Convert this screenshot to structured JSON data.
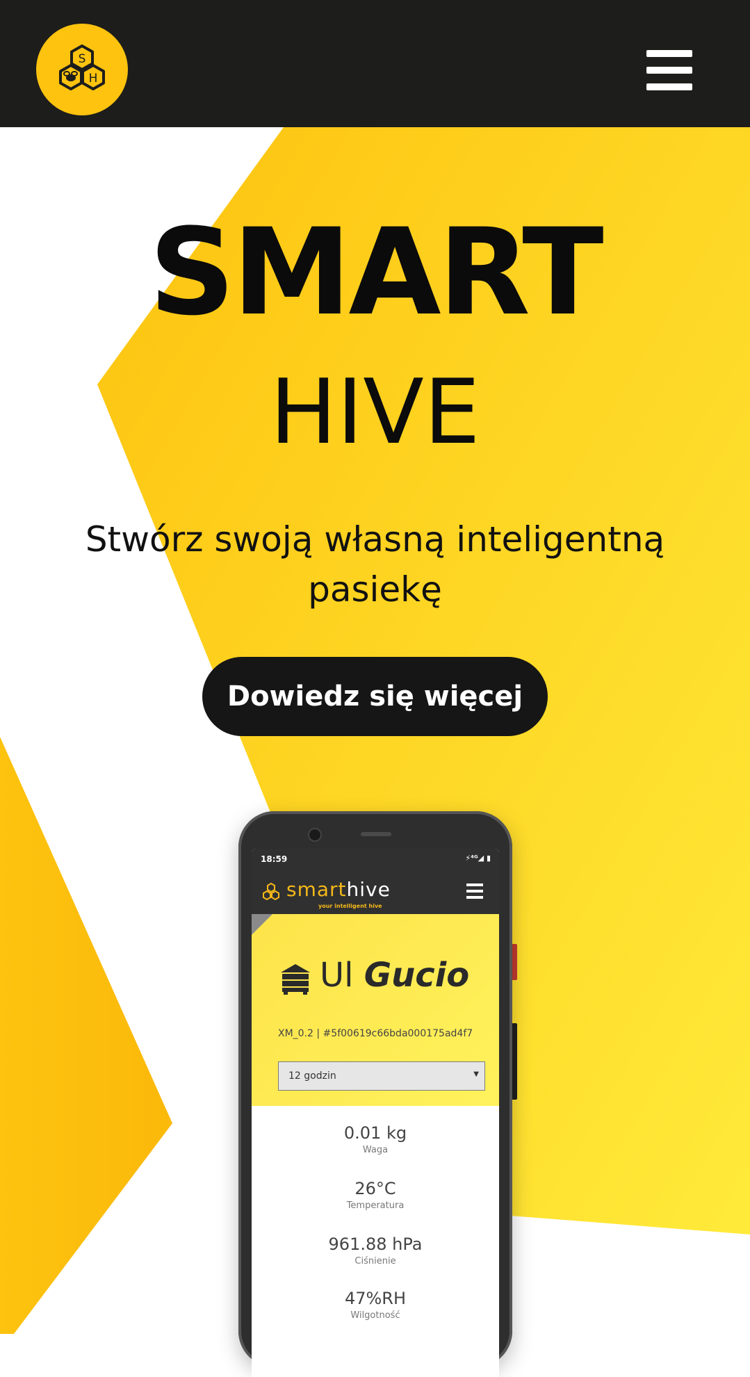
{
  "header": {
    "logo_letters": [
      "S",
      "H"
    ]
  },
  "hero": {
    "title": "SMART",
    "subtitle": "HIVE",
    "tagline": "Stwórz swoją własną inteligentną pasiekę",
    "cta_label": "Dowiedz się więcej"
  },
  "phone": {
    "status_time": "18:59",
    "status_icons": "⚡⁴ᴳ◢ ▮",
    "brand_accent": "smart",
    "brand_rest": "hive",
    "brand_tagline": "your intelligent hive",
    "hive_prefix": "Ul",
    "hive_name": "Gucio",
    "device_id": "XM_0.2 | #5f00619c66bda000175ad4f7",
    "range_value": "12 godzin",
    "metrics": [
      {
        "value": "0.01 kg",
        "label": "Waga"
      },
      {
        "value": "26°C",
        "label": "Temperatura"
      },
      {
        "value": "961.88 hPa",
        "label": "Ciśnienie"
      },
      {
        "value": "47%RH",
        "label": "Wilgotność"
      }
    ]
  },
  "colors": {
    "brand_yellow": "#fdc30f",
    "dark": "#1d1d1b",
    "white": "#ffffff"
  }
}
